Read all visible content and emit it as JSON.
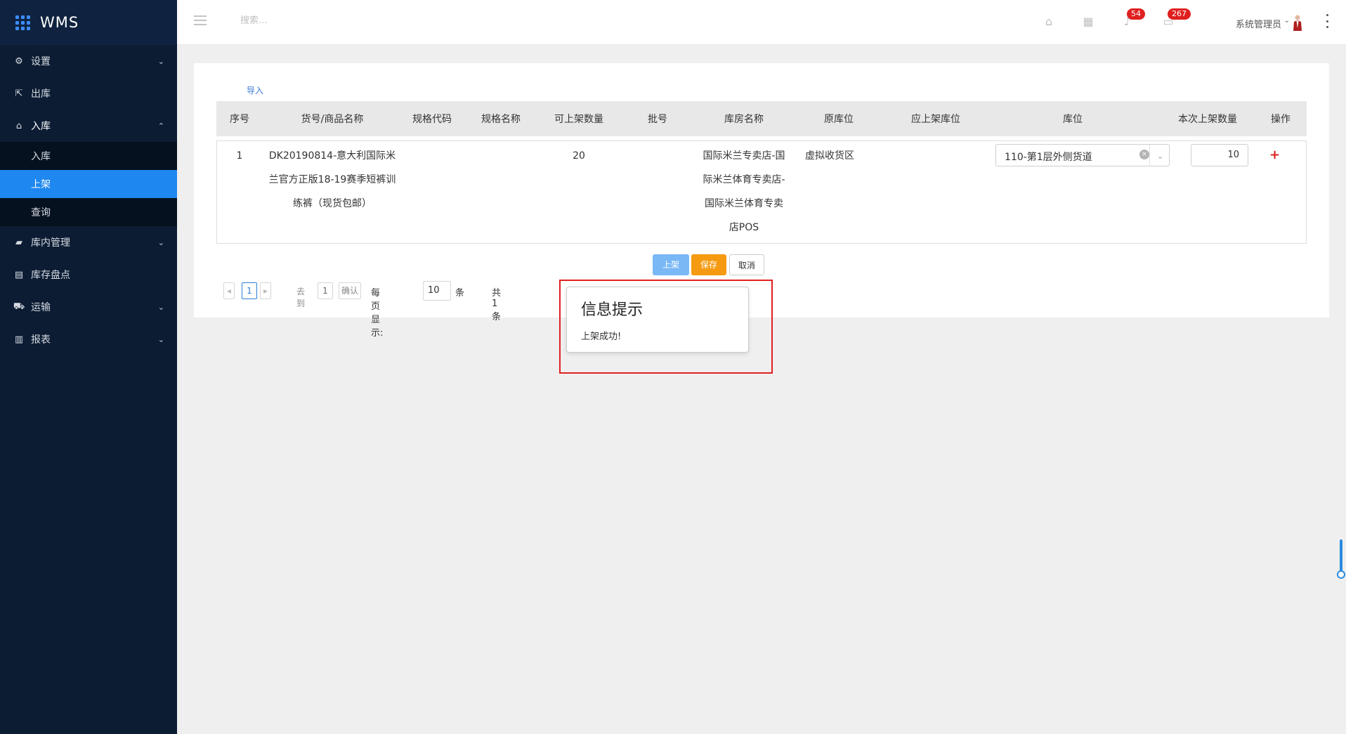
{
  "app": {
    "title": "WMS"
  },
  "sidebar": {
    "items": [
      {
        "label": "设置",
        "icon": "gear-icon"
      },
      {
        "label": "出库",
        "icon": "export-icon"
      },
      {
        "label": "入库",
        "icon": "home-icon",
        "open": true,
        "children": [
          {
            "label": "入库"
          },
          {
            "label": "上架",
            "active": true
          },
          {
            "label": "查询"
          }
        ]
      },
      {
        "label": "库内管理",
        "icon": "warehouse-icon"
      },
      {
        "label": "库存盘点",
        "icon": "inventory-icon"
      },
      {
        "label": "运输",
        "icon": "truck-icon"
      },
      {
        "label": "报表",
        "icon": "chart-icon"
      }
    ]
  },
  "header": {
    "search_placeholder": "搜索...",
    "notifications_count": "54",
    "messages_count": "267",
    "user_name": "系统管理员"
  },
  "main": {
    "import_label": "导入",
    "columns": [
      "序号",
      "货号/商品名称",
      "规格代码",
      "规格名称",
      "可上架数量",
      "批号",
      "库房名称",
      "原库位",
      "应上架库位",
      "库位",
      "本次上架数量",
      "操作"
    ],
    "row": {
      "index": "1",
      "product_line1": "DK20190814-意大利国际米",
      "product_line2": "兰官方正版18-19赛季短裤训",
      "product_line3": "练裤（现货包邮）",
      "available_qty": "20",
      "warehouse_line1": "国际米兰专卖店-国",
      "warehouse_line2": "际米兰体育专卖店-",
      "warehouse_line3": "国际米兰体育专卖",
      "warehouse_line4": "店POS",
      "original_location": "虚拟收货区",
      "location_value": "110-第1层外侧货道",
      "shelve_qty": "10",
      "add_symbol": "+"
    },
    "buttons": {
      "shelve": "上架",
      "save": "保存",
      "cancel": "取消"
    },
    "pagination": {
      "current_page": "1",
      "goto_label": "去到",
      "goto_value": "1",
      "confirm": "确认",
      "per_page_label": "每页显示:",
      "per_page_value": "10",
      "per_page_unit": "条",
      "total": "共 1条"
    }
  },
  "dialog": {
    "title": "信息提示",
    "message": "上架成功!"
  },
  "colors": {
    "sidebar": "#0b1c33",
    "accent": "#1e87f0",
    "save": "#f59a11",
    "highlight": "#e02020"
  }
}
